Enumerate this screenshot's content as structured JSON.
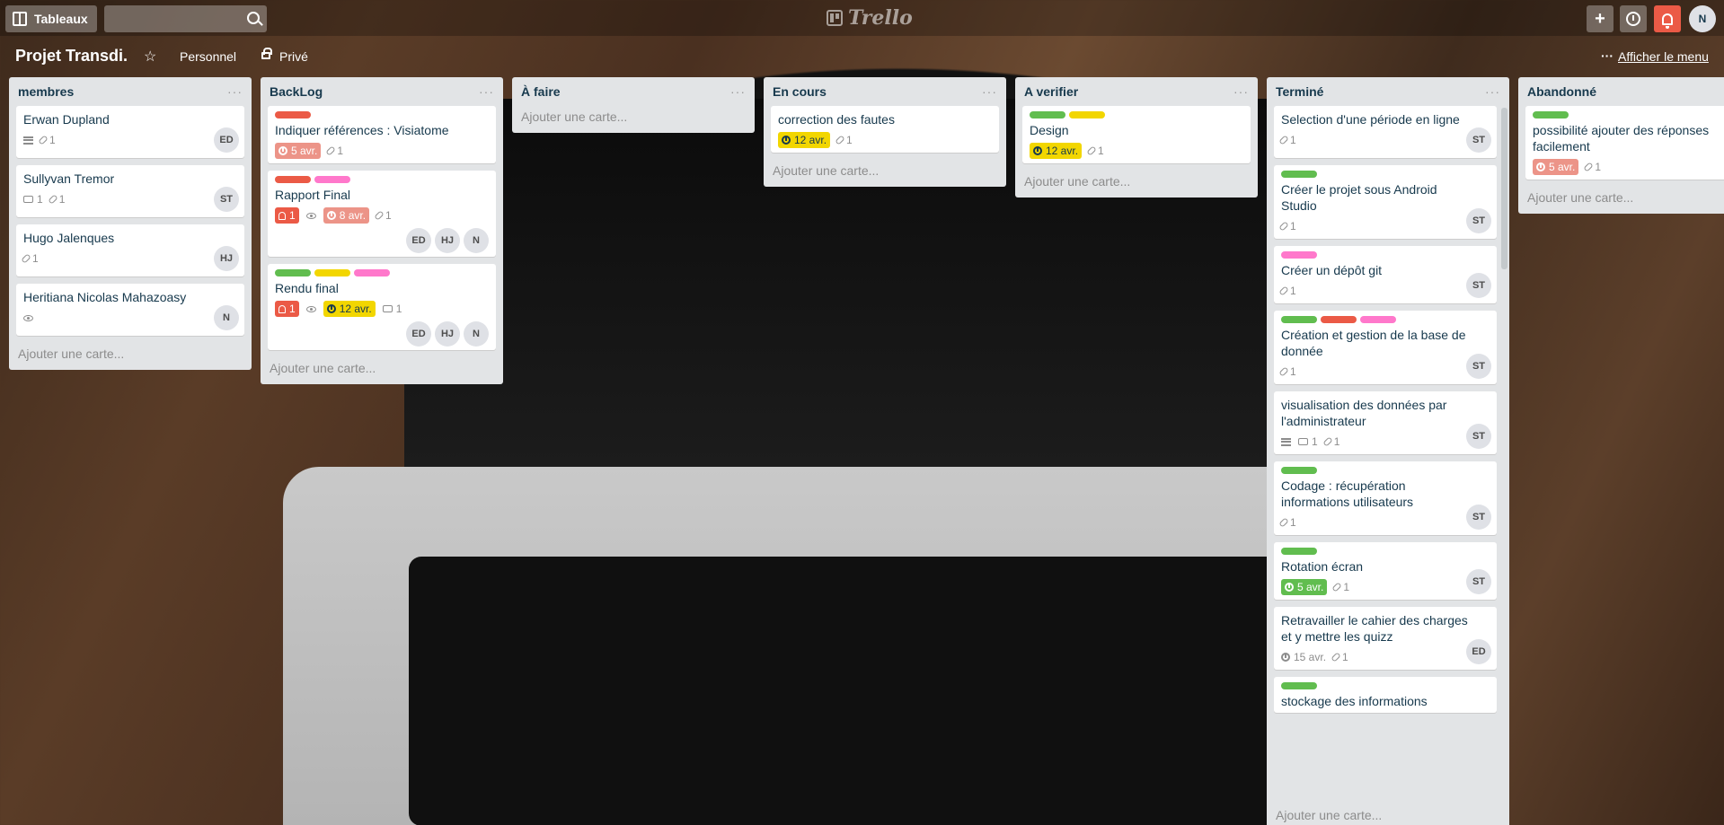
{
  "header": {
    "boards_label": "Tableaux",
    "search": {
      "value": "",
      "placeholder": ""
    },
    "logo": "Trello",
    "user_initial": "N",
    "add_label": "+"
  },
  "board": {
    "title": "Projet Transdi.",
    "team": "Personnel",
    "visibility": "Privé",
    "menu_label": "Afficher le menu",
    "add_card_label": "Ajouter une carte..."
  },
  "lists": [
    {
      "name": "membres",
      "cards": [
        {
          "title": "Erwan Dupland",
          "description": true,
          "attachments": "1",
          "members": [
            "ED"
          ]
        },
        {
          "title": "Sullyvan Tremor",
          "comments": "1",
          "attachments": "1",
          "members": [
            "ST"
          ]
        },
        {
          "title": "Hugo Jalenques",
          "attachments": "1",
          "members": [
            "HJ"
          ]
        },
        {
          "title": "Heritiana Nicolas Mahazoasy",
          "watch": true,
          "members": [
            "N"
          ]
        }
      ]
    },
    {
      "name": "BackLog",
      "cards": [
        {
          "title": "Indiquer références : Visiatome",
          "labels": [
            "#eb5a46"
          ],
          "due": "5 avr.",
          "due_style": "redlight",
          "attachments": "1"
        },
        {
          "title": "Rapport Final",
          "labels": [
            "#eb5a46",
            "#ff78cb"
          ],
          "notifications": "1",
          "watch": true,
          "due": "8 avr.",
          "due_style": "redlight",
          "attachments": "1",
          "members": [
            "ED",
            "HJ",
            "N"
          ]
        },
        {
          "title": "Rendu final",
          "labels": [
            "#61bd4f",
            "#f2d600",
            "#ff78cb"
          ],
          "notifications": "1",
          "watch": true,
          "due": "12 avr.",
          "due_style": "yellow",
          "comments": "1",
          "members": [
            "ED",
            "HJ",
            "N"
          ]
        }
      ]
    },
    {
      "name": "À faire",
      "cards": []
    },
    {
      "name": "En cours",
      "cards": [
        {
          "title": "correction des fautes",
          "due": "12 avr.",
          "due_style": "yellow",
          "attachments": "1"
        }
      ]
    },
    {
      "name": "A verifier",
      "cards": [
        {
          "title": "Design",
          "labels": [
            "#61bd4f",
            "#f2d600"
          ],
          "due": "12 avr.",
          "due_style": "yellow",
          "attachments": "1"
        }
      ]
    },
    {
      "name": "Terminé",
      "cards": [
        {
          "title": "Selection d'une période en ligne",
          "attachments": "1",
          "members": [
            "ST"
          ]
        },
        {
          "title": "Créer le projet sous Android Studio",
          "labels": [
            "#61bd4f"
          ],
          "attachments": "1",
          "members": [
            "ST"
          ]
        },
        {
          "title": "Créer un dépôt git",
          "labels": [
            "#ff78cb"
          ],
          "attachments": "1",
          "members": [
            "ST"
          ]
        },
        {
          "title": "Création et gestion de la base de donnée",
          "labels": [
            "#61bd4f",
            "#eb5a46",
            "#ff78cb"
          ],
          "attachments": "1",
          "members": [
            "ST"
          ]
        },
        {
          "title": "visualisation des données par l'administrateur",
          "description": true,
          "comments": "1",
          "attachments": "1",
          "members": [
            "ST"
          ]
        },
        {
          "title": "Codage : récupération informations utilisateurs",
          "labels": [
            "#61bd4f"
          ],
          "attachments": "1",
          "members": [
            "ST"
          ]
        },
        {
          "title": "Rotation écran",
          "labels": [
            "#61bd4f"
          ],
          "due": "5 avr.",
          "due_style": "green",
          "attachments": "1",
          "members": [
            "ST"
          ]
        },
        {
          "title": "Retravailler le cahier des charges et y mettre les quizz",
          "due": "15 avr.",
          "due_style": "plain",
          "attachments": "1",
          "members": [
            "ED"
          ]
        },
        {
          "title": "stockage des informations",
          "labels": [
            "#61bd4f"
          ]
        }
      ]
    },
    {
      "name": "Abandonné",
      "cards": [
        {
          "title": "possibilité ajouter des réponses facilement",
          "labels": [
            "#61bd4f"
          ],
          "due": "5 avr.",
          "due_style": "redlight",
          "attachments": "1"
        }
      ]
    }
  ]
}
